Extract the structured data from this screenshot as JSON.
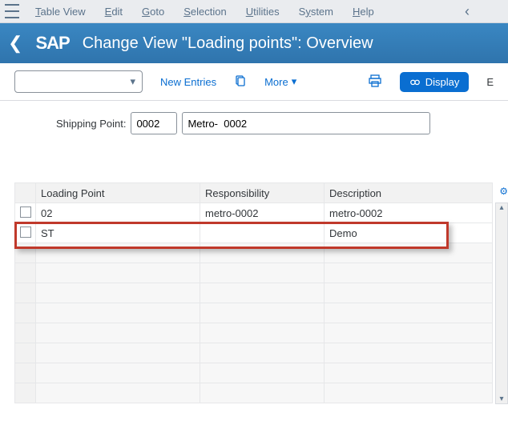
{
  "menubar": {
    "items": [
      {
        "label_pre": "",
        "u": "T",
        "label_post": "able View"
      },
      {
        "label_pre": "",
        "u": "E",
        "label_post": "dit"
      },
      {
        "label_pre": "",
        "u": "G",
        "label_post": "oto"
      },
      {
        "label_pre": "",
        "u": "S",
        "label_post": "election"
      },
      {
        "label_pre": "",
        "u": "U",
        "label_post": "tilities"
      },
      {
        "label_pre": "S",
        "u": "y",
        "label_post": "stem"
      },
      {
        "label_pre": "",
        "u": "H",
        "label_post": "elp"
      }
    ]
  },
  "titlebar": {
    "logo_text": "SAP",
    "title": "Change View \"Loading points\": Overview"
  },
  "toolbar": {
    "new_entries": "New Entries",
    "more": "More",
    "display": "Display",
    "right_letter": "E"
  },
  "form": {
    "shipping_label": "Shipping Point:",
    "shipping_code": "0002",
    "shipping_desc": "Metro-  0002"
  },
  "table": {
    "headers": {
      "c0": "",
      "c1": "Loading Point",
      "c2": "Responsibility",
      "c3": "Description"
    },
    "rows": [
      {
        "c1": "02",
        "c2": "metro-0002",
        "c3": "metro-0002"
      },
      {
        "c1": "ST",
        "c2": "",
        "c3": "Demo"
      }
    ]
  }
}
